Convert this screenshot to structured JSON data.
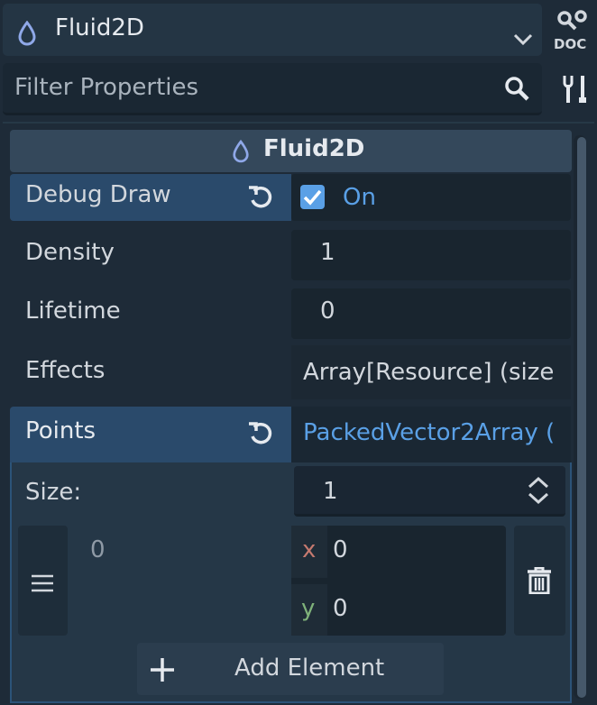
{
  "header": {
    "node_name": "Fluid2D",
    "doc_label": "DOC"
  },
  "filter": {
    "placeholder": "Filter Properties"
  },
  "section": {
    "title": "Fluid2D"
  },
  "properties": {
    "debug_draw": {
      "label": "Debug Draw",
      "value": "On",
      "checked": true
    },
    "density": {
      "label": "Density",
      "value": "1"
    },
    "lifetime": {
      "label": "Lifetime",
      "value": "0"
    },
    "effects": {
      "label": "Effects",
      "value": "Array[Resource] (size"
    },
    "points": {
      "label": "Points",
      "value": "PackedVector2Array ("
    }
  },
  "array_editor": {
    "size_label": "Size:",
    "size_value": "1",
    "elements": [
      {
        "index": "0",
        "x_label": "x",
        "x": "0",
        "y_label": "y",
        "y": "0"
      }
    ],
    "add_label": "Add Element"
  },
  "colors": {
    "accent": "#5aa0e6",
    "highlight_row": "#2a4a6b",
    "background": "#1e2b38",
    "node_icon": "#8fa8e8"
  }
}
